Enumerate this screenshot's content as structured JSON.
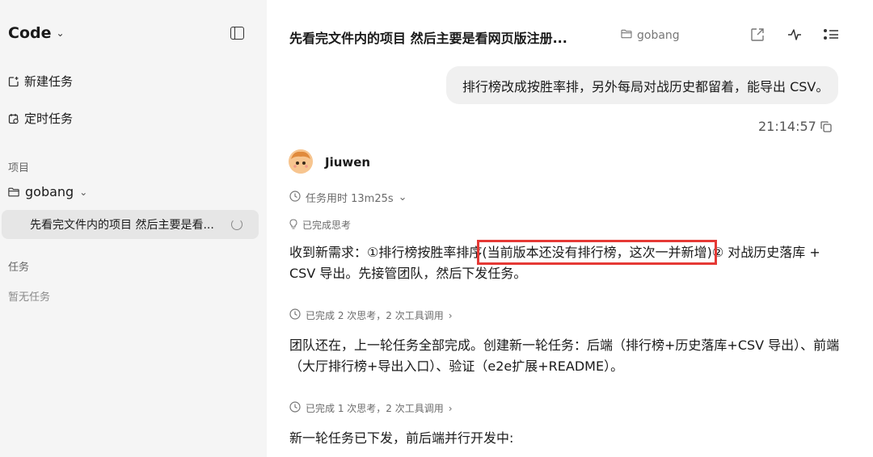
{
  "sidebar": {
    "app_title": "Code",
    "new_task": "新建任务",
    "scheduled_task": "定时任务",
    "projects_label": "项目",
    "project_name": "gobang",
    "selected_task": "先看完文件内的项目 然后主要是看...",
    "tasks_label": "任务",
    "tasks_empty": "暂无任务"
  },
  "header": {
    "title": "先看完文件内的项目 然后主要是看网页版注册...",
    "folder": "gobang"
  },
  "conversation": {
    "user_message": "排行榜改成按胜率排，另外每局对战历史都留着，能导出 CSV。",
    "timestamp": "21:14:57",
    "agent_name": "Jiuwen",
    "duration": "任务用时 13m25s",
    "thinking_done": "已完成思考",
    "msg1_before": "收到新需求：①排行榜按胜率排序",
    "msg1_highlight": "(当前版本还没有排行榜，这次一并新增)",
    "msg1_after": "② 对战历史落库 + CSV 导出。先接管团队，然后下发任务。",
    "step2": "已完成 2 次思考，2 次工具调用",
    "msg2": "团队还在，上一轮任务全部完成。创建新一轮任务：后端（排行榜+历史落库+CSV 导出）、前端（大厅排行榜+导出入口）、验证（e2e扩展+README）。",
    "step3": "已完成 1 次思考，2 次工具调用",
    "msg3": "新一轮任务已下发，前后端并行开发中:"
  },
  "colors": {
    "sidebar_bg": "#f5f5f5",
    "highlight": "#e53935",
    "bubble_bg": "#f0f0f0"
  }
}
